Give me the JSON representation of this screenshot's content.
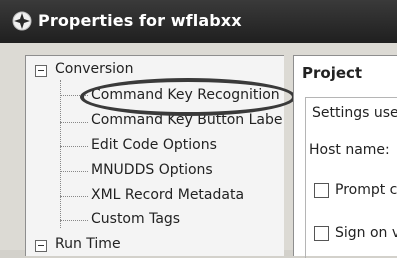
{
  "window": {
    "title": "Properties for wflabxx",
    "icon": "properties-icon"
  },
  "tree": {
    "items": [
      {
        "label": "Conversion",
        "expander": "−"
      },
      {
        "label": "Command Key Recognition"
      },
      {
        "label": "Command Key Button Labe"
      },
      {
        "label": "Edit Code Options"
      },
      {
        "label": "MNUDDS Options"
      },
      {
        "label": "XML Record Metadata"
      },
      {
        "label": "Custom Tags"
      },
      {
        "label": "Run Time",
        "expander": "−"
      }
    ]
  },
  "right_panel": {
    "title": "Project",
    "group_label": "Settings use",
    "host_label": "Host name:",
    "checkbox1_label": "Prompt c",
    "checkbox2_label": "Sign on v"
  },
  "colors": {
    "titlebar": "#2a2a2a",
    "highlight": "#3a3a3a"
  }
}
